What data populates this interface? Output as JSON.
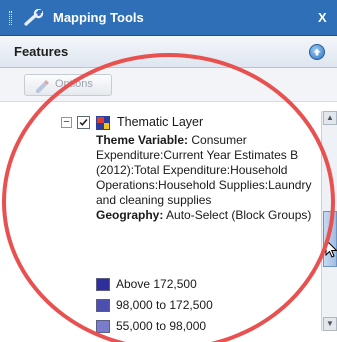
{
  "window": {
    "title": "Mapping Tools",
    "close_label": "X"
  },
  "features": {
    "title": "Features"
  },
  "toolbar": {
    "options_label": "Options"
  },
  "layer": {
    "toggle_symbol": "−",
    "name": "Thematic Layer",
    "checked": true,
    "theme_variable_label": "Theme Variable:",
    "theme_variable_value": " Consumer Expenditure:Current Year Estimates B (2012):Total Expenditure:Household Operations:Household Supplies:Laundry and cleaning supplies",
    "geography_label": "Geography:",
    "geography_value": " Auto-Select (Block Groups)"
  },
  "legend": [
    {
      "label": "Above 172,500",
      "color": "#2f2f9c"
    },
    {
      "label": "98,000 to 172,500",
      "color": "#4d4fb0"
    },
    {
      "label": "55,000 to 98,000",
      "color": "#7a7bcb"
    }
  ],
  "colors": {
    "title_bar": "#2f6fb8",
    "highlight": "#e8514f"
  }
}
